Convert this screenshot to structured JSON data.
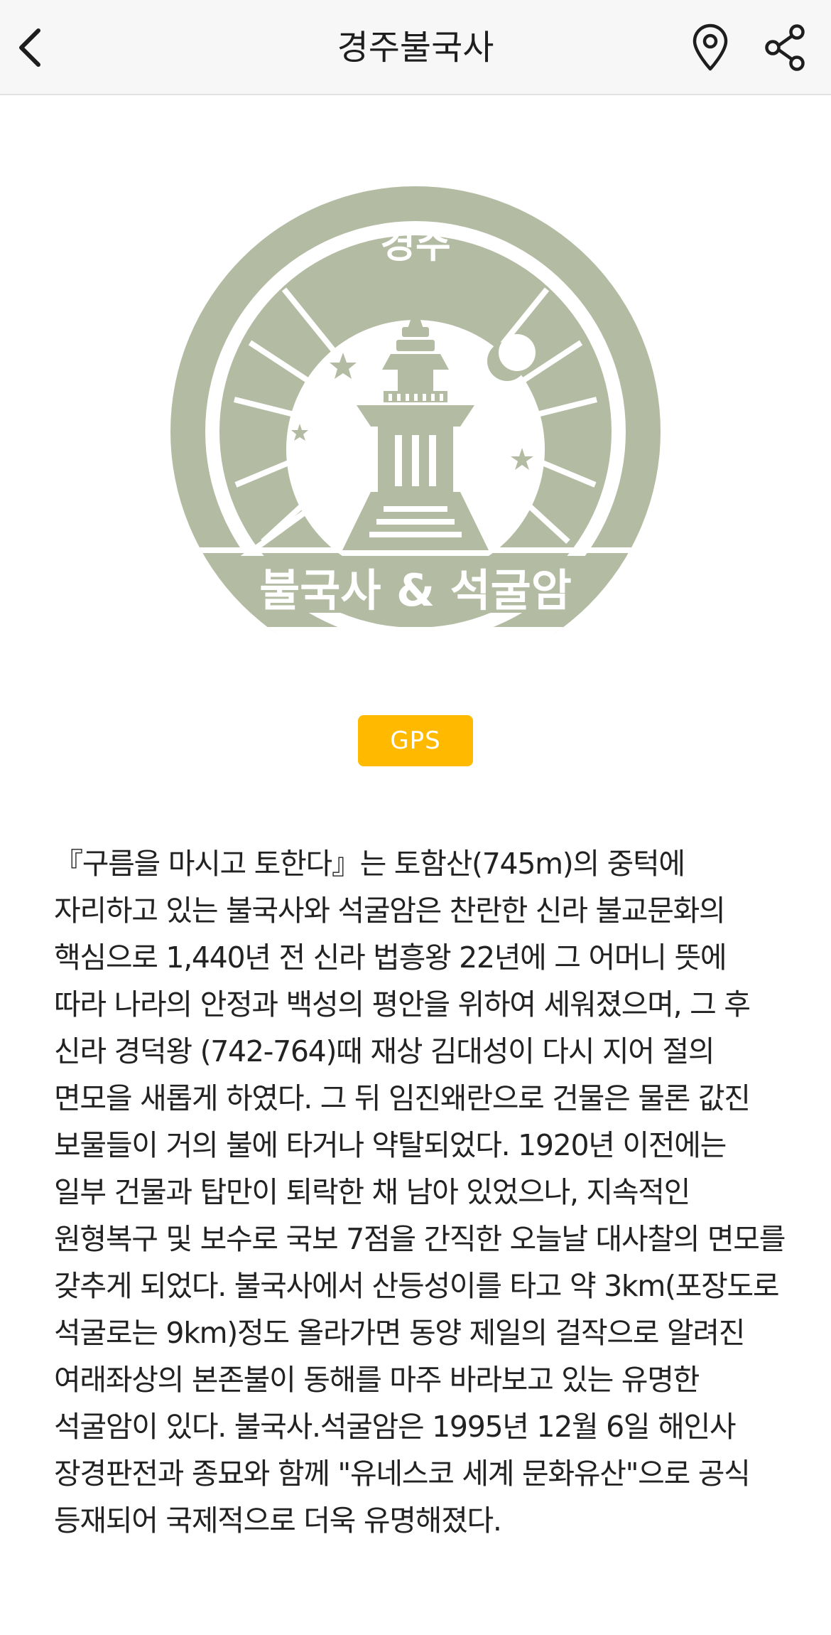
{
  "header": {
    "title": "경주불국사",
    "back_icon": "chevron-left-icon",
    "location_icon": "map-pin-icon",
    "share_icon": "share-icon"
  },
  "badge": {
    "top_text": "경주",
    "bottom_text": "불국사 & 석굴암",
    "color": "#b3bca3"
  },
  "gps_button": {
    "label": "GPS",
    "color": "#ffba00"
  },
  "description": "『구름을 마시고 토한다』는 토함산(745m)의 중턱에 자리하고 있는 불국사와 석굴암은 찬란한 신라 불교문화의 핵심으로 1,440년 전 신라 법흥왕 22년에 그 어머니 뜻에 따라 나라의 안정과 백성의 평안을 위하여 세워졌으며, 그 후 신라 경덕왕 (742-764)때 재상 김대성이 다시 지어 절의 면모을 새롭게 하였다. 그 뒤 임진왜란으로 건물은 물론 값진 보물들이 거의 불에 타거나 약탈되었다. 1920년 이전에는 일부 건물과 탑만이 퇴락한 채 남아 있었으나, 지속적인 원형복구 및 보수로 국보 7점을 간직한 오늘날 대사찰의 면모를 갖추게 되었다. 불국사에서 산등성이를 타고 약 3km(포장도로 석굴로는 9km)정도 올라가면 동양 제일의 걸작으로 알려진 여래좌상의 본존불이 동해를 마주 바라보고 있는 유명한 석굴암이 있다. 불국사.석굴암은 1995년 12월 6일 해인사 장경판전과 종묘와 함께 \"유네스코 세계 문화유산\"으로 공식 등재되어 국제적으로 더욱 유명해졌다."
}
